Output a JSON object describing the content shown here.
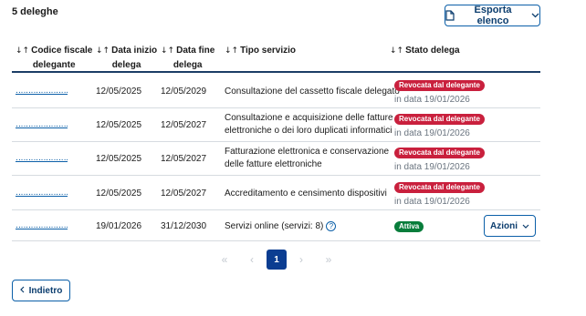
{
  "summary": {
    "count_label": "5 deleghe"
  },
  "toolbar": {
    "export_label": "Esporta elenco"
  },
  "table": {
    "columns": [
      {
        "line1": "Codice fiscale",
        "line2": "delegante"
      },
      {
        "line1": "Data inizio",
        "line2": "delega"
      },
      {
        "line1": "Data fine",
        "line2": "delega"
      },
      {
        "line1": "Tipo servizio",
        "line2": ""
      },
      {
        "line1": "Stato delega",
        "line2": ""
      }
    ],
    "rows": [
      {
        "code": "‥‥‥‥‥‥‥‥‥‥‥‥‥‥‥‥‥1",
        "start": "12/05/2025",
        "end": "12/05/2029",
        "service_l1": "Consultazione del cassetto fiscale delegato",
        "service_l2": "",
        "status": "Revocata dal delegante",
        "status_date": "in data 19/01/2026"
      },
      {
        "code": "‥‥‥‥‥‥‥‥‥‥‥‥‥‥‥‥‥1",
        "start": "12/05/2025",
        "end": "12/05/2027",
        "service_l1": "Consultazione e acquisizione delle fatture",
        "service_l2": "elettroniche o dei loro duplicati informatici",
        "status": "Revocata dal delegante",
        "status_date": "in data 19/01/2026"
      },
      {
        "code": "‥‥‥‥‥‥‥‥‥‥‥‥‥‥‥‥‥1",
        "start": "12/05/2025",
        "end": "12/05/2027",
        "service_l1": "Fatturazione elettronica e conservazione",
        "service_l2": "delle fatture elettroniche",
        "status": "Revocata dal delegante",
        "status_date": "in data 19/01/2026"
      },
      {
        "code": "‥‥‥‥‥‥‥‥‥‥‥‥‥‥‥‥‥2",
        "start": "12/05/2025",
        "end": "12/05/2027",
        "service_l1": "Accreditamento e censimento dispositivi",
        "service_l2": "",
        "status": "Revocata dal delegante",
        "status_date": "in data 19/01/2026"
      },
      {
        "code": "‥‥‥‥‥‥‥‥‥‥‥‥‥‥‥‥‥1",
        "start": "19/01/2026",
        "end": "31/12/2030",
        "service_l1": "Servizi online (servizi: 8)",
        "service_l2": "",
        "status": "Attiva",
        "status_date": "",
        "actions_label": "Azioni"
      }
    ]
  },
  "pagination": {
    "current_page": "1"
  },
  "footer": {
    "back_label": "Indietro"
  },
  "colors": {
    "accent": "#0b5fa8",
    "revoked": "#c9203d",
    "active": "#087d3b",
    "page_active": "#0b3d91"
  }
}
